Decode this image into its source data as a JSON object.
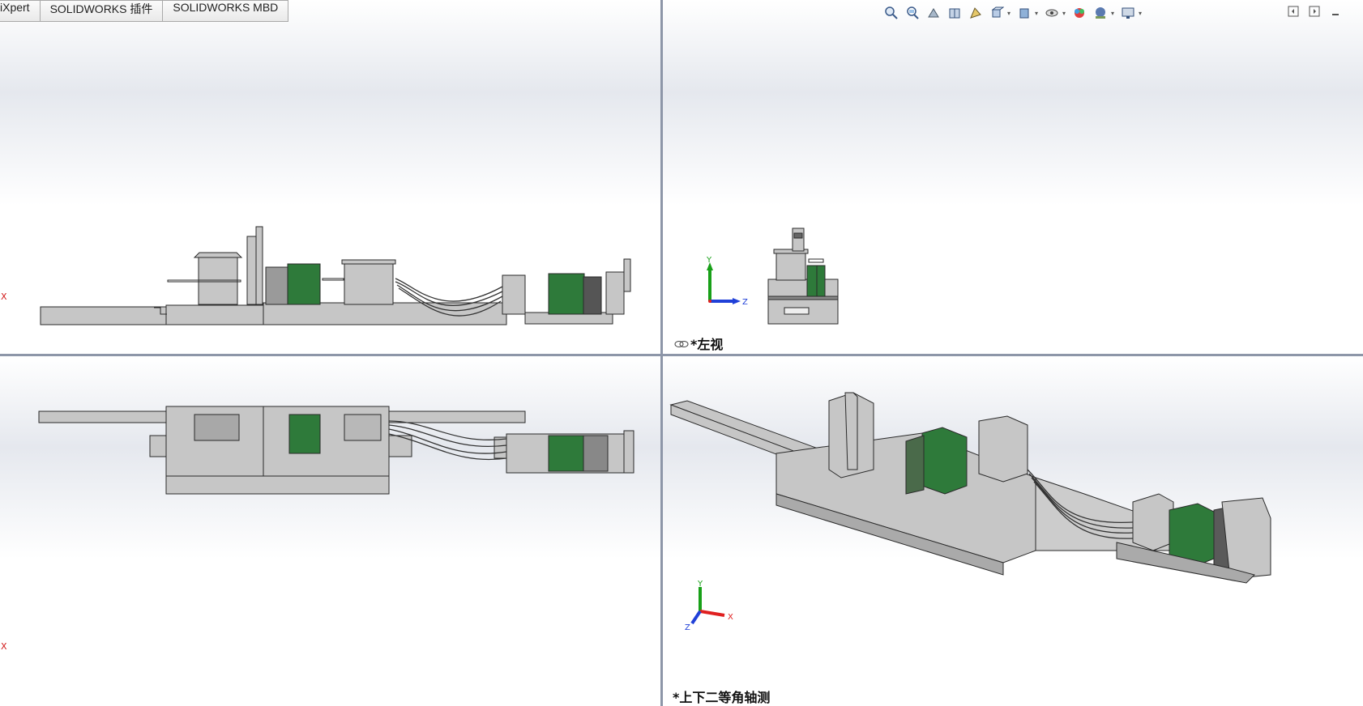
{
  "tabs": [
    {
      "label": "iXpert"
    },
    {
      "label": "SOLIDWORKS 插件"
    },
    {
      "label": "SOLIDWORKS MBD"
    }
  ],
  "views": {
    "top_right": {
      "label": "*左视"
    },
    "bottom_right": {
      "label": "*上下二等角轴测"
    }
  },
  "triad": {
    "x": "X",
    "y": "Y",
    "z": "Z"
  },
  "colors": {
    "model_green": "#2e7a3a",
    "model_grey": "#c3c3c3",
    "edge": "#2a2a2a",
    "axis_x": "#e02020",
    "axis_y": "#18a018",
    "axis_z": "#2040d8"
  },
  "toolbar_icons": [
    "zoom-to-fit-icon",
    "zoom-to-area-icon",
    "previous-view-icon",
    "section-view-icon",
    "dynamic-annotation-icon",
    "view-orientation-icon",
    "display-style-icon",
    "hide-show-icon",
    "edit-appearance-icon",
    "apply-scene-icon",
    "view-settings-icon"
  ],
  "window_controls": [
    "tile-left-icon",
    "tile-right-icon",
    "minimize-icon"
  ]
}
